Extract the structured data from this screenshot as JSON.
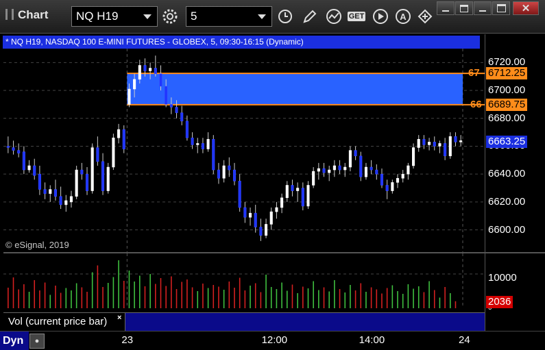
{
  "window": {
    "title": "Chart"
  },
  "toolbar": {
    "symbol": "NQ H19",
    "interval": "5",
    "icons": [
      "gear-icon",
      "clock-icon",
      "pencil-icon",
      "study-icon",
      "get-icon",
      "play-icon",
      "alert-icon",
      "cursor-icon"
    ],
    "get_label": "GET",
    "alert_label": "A"
  },
  "info_bar": {
    "text": "* NQ H19, NASDAQ 100 E-MINI FUTURES - GLOBEX, 5, 09:30-16:15 (Dynamic)"
  },
  "watermark": "© eSignal, 2019",
  "price_axis": {
    "labels": [
      "6720.00",
      "6700.00",
      "6680.00",
      "6660.00",
      "6640.00",
      "6620.00",
      "6600.00"
    ]
  },
  "price_tags": {
    "upper_level": {
      "label": "67",
      "value": "6712.25",
      "color": "#ff8c1a"
    },
    "lower_level": {
      "label": "66",
      "value": "6689.75",
      "color": "#ff8c1a"
    },
    "last": {
      "value": "6663.25",
      "color": "#1b2fe0"
    }
  },
  "volume_axis": {
    "label": "10000",
    "zero": "0"
  },
  "volume_tag": {
    "value": "2036",
    "color": "#d40000"
  },
  "volume_panel": {
    "label": "Vol (current price bar)",
    "close": "×"
  },
  "time_axis": {
    "labels": [
      "23",
      "12:00",
      "14:00",
      "24"
    ]
  },
  "status": {
    "mode": "Dyn"
  },
  "chart_data": {
    "type": "candlestick",
    "title": "",
    "y_range": [
      6588,
      6730
    ],
    "highlight_zone": {
      "low": 6689.75,
      "high": 6712.25,
      "color": "#2962ff",
      "line_color": "#ff8c1a"
    },
    "last_price": 6663.25,
    "candles": [
      {
        "o": 6660,
        "h": 6667,
        "l": 6655,
        "c": 6659
      },
      {
        "o": 6659,
        "h": 6664,
        "l": 6654,
        "c": 6657
      },
      {
        "o": 6657,
        "h": 6662,
        "l": 6652,
        "c": 6655
      },
      {
        "o": 6656,
        "h": 6660,
        "l": 6640,
        "c": 6643
      },
      {
        "o": 6643,
        "h": 6650,
        "l": 6641,
        "c": 6646
      },
      {
        "o": 6646,
        "h": 6651,
        "l": 6636,
        "c": 6639
      },
      {
        "o": 6640,
        "h": 6646,
        "l": 6625,
        "c": 6629
      },
      {
        "o": 6629,
        "h": 6634,
        "l": 6622,
        "c": 6626
      },
      {
        "o": 6626,
        "h": 6632,
        "l": 6620,
        "c": 6629
      },
      {
        "o": 6629,
        "h": 6636,
        "l": 6621,
        "c": 6624
      },
      {
        "o": 6624,
        "h": 6631,
        "l": 6615,
        "c": 6618
      },
      {
        "o": 6618,
        "h": 6625,
        "l": 6613,
        "c": 6621
      },
      {
        "o": 6620,
        "h": 6628,
        "l": 6616,
        "c": 6624
      },
      {
        "o": 6624,
        "h": 6646,
        "l": 6622,
        "c": 6643
      },
      {
        "o": 6643,
        "h": 6648,
        "l": 6636,
        "c": 6640
      },
      {
        "o": 6640,
        "h": 6645,
        "l": 6625,
        "c": 6628
      },
      {
        "o": 6628,
        "h": 6662,
        "l": 6626,
        "c": 6659
      },
      {
        "o": 6659,
        "h": 6667,
        "l": 6646,
        "c": 6649
      },
      {
        "o": 6649,
        "h": 6655,
        "l": 6625,
        "c": 6628
      },
      {
        "o": 6628,
        "h": 6648,
        "l": 6626,
        "c": 6645
      },
      {
        "o": 6645,
        "h": 6669,
        "l": 6643,
        "c": 6666
      },
      {
        "o": 6666,
        "h": 6676,
        "l": 6662,
        "c": 6672
      },
      {
        "o": 6672,
        "h": 6675,
        "l": 6655,
        "c": 6658
      },
      {
        "o": 6690,
        "h": 6705,
        "l": 6688,
        "c": 6701
      },
      {
        "o": 6701,
        "h": 6712,
        "l": 6695,
        "c": 6708
      },
      {
        "o": 6708,
        "h": 6722,
        "l": 6705,
        "c": 6718
      },
      {
        "o": 6718,
        "h": 6723,
        "l": 6710,
        "c": 6714
      },
      {
        "o": 6714,
        "h": 6720,
        "l": 6708,
        "c": 6716
      },
      {
        "o": 6716,
        "h": 6725,
        "l": 6710,
        "c": 6712
      },
      {
        "o": 6712,
        "h": 6718,
        "l": 6700,
        "c": 6703
      },
      {
        "o": 6703,
        "h": 6708,
        "l": 6688,
        "c": 6690
      },
      {
        "o": 6690,
        "h": 6695,
        "l": 6683,
        "c": 6688
      },
      {
        "o": 6688,
        "h": 6693,
        "l": 6680,
        "c": 6684
      },
      {
        "o": 6684,
        "h": 6689,
        "l": 6675,
        "c": 6678
      },
      {
        "o": 6678,
        "h": 6682,
        "l": 6664,
        "c": 6666
      },
      {
        "o": 6666,
        "h": 6670,
        "l": 6658,
        "c": 6661
      },
      {
        "o": 6661,
        "h": 6666,
        "l": 6655,
        "c": 6662
      },
      {
        "o": 6662,
        "h": 6666,
        "l": 6655,
        "c": 6658
      },
      {
        "o": 6658,
        "h": 6670,
        "l": 6656,
        "c": 6665
      },
      {
        "o": 6665,
        "h": 6668,
        "l": 6640,
        "c": 6643
      },
      {
        "o": 6643,
        "h": 6648,
        "l": 6633,
        "c": 6637
      },
      {
        "o": 6637,
        "h": 6650,
        "l": 6634,
        "c": 6646
      },
      {
        "o": 6646,
        "h": 6652,
        "l": 6638,
        "c": 6643
      },
      {
        "o": 6643,
        "h": 6648,
        "l": 6632,
        "c": 6635
      },
      {
        "o": 6635,
        "h": 6640,
        "l": 6613,
        "c": 6616
      },
      {
        "o": 6616,
        "h": 6620,
        "l": 6605,
        "c": 6609
      },
      {
        "o": 6609,
        "h": 6616,
        "l": 6603,
        "c": 6612
      },
      {
        "o": 6612,
        "h": 6618,
        "l": 6598,
        "c": 6602
      },
      {
        "o": 6602,
        "h": 6608,
        "l": 6592,
        "c": 6596
      },
      {
        "o": 6596,
        "h": 6608,
        "l": 6594,
        "c": 6604
      },
      {
        "o": 6604,
        "h": 6616,
        "l": 6600,
        "c": 6613
      },
      {
        "o": 6613,
        "h": 6620,
        "l": 6608,
        "c": 6616
      },
      {
        "o": 6616,
        "h": 6626,
        "l": 6612,
        "c": 6623
      },
      {
        "o": 6623,
        "h": 6635,
        "l": 6620,
        "c": 6632
      },
      {
        "o": 6632,
        "h": 6636,
        "l": 6624,
        "c": 6628
      },
      {
        "o": 6628,
        "h": 6634,
        "l": 6620,
        "c": 6630
      },
      {
        "o": 6630,
        "h": 6634,
        "l": 6614,
        "c": 6617
      },
      {
        "o": 6617,
        "h": 6635,
        "l": 6615,
        "c": 6632
      },
      {
        "o": 6632,
        "h": 6645,
        "l": 6630,
        "c": 6642
      },
      {
        "o": 6642,
        "h": 6648,
        "l": 6636,
        "c": 6644
      },
      {
        "o": 6644,
        "h": 6648,
        "l": 6638,
        "c": 6641
      },
      {
        "o": 6641,
        "h": 6646,
        "l": 6635,
        "c": 6643
      },
      {
        "o": 6643,
        "h": 6650,
        "l": 6638,
        "c": 6646
      },
      {
        "o": 6646,
        "h": 6650,
        "l": 6640,
        "c": 6643
      },
      {
        "o": 6643,
        "h": 6648,
        "l": 6638,
        "c": 6645
      },
      {
        "o": 6645,
        "h": 6660,
        "l": 6642,
        "c": 6657
      },
      {
        "o": 6657,
        "h": 6660,
        "l": 6650,
        "c": 6653
      },
      {
        "o": 6653,
        "h": 6656,
        "l": 6635,
        "c": 6638
      },
      {
        "o": 6638,
        "h": 6648,
        "l": 6636,
        "c": 6645
      },
      {
        "o": 6645,
        "h": 6650,
        "l": 6640,
        "c": 6643
      },
      {
        "o": 6643,
        "h": 6647,
        "l": 6636,
        "c": 6640
      },
      {
        "o": 6640,
        "h": 6644,
        "l": 6630,
        "c": 6632
      },
      {
        "o": 6632,
        "h": 6636,
        "l": 6622,
        "c": 6628
      },
      {
        "o": 6628,
        "h": 6636,
        "l": 6626,
        "c": 6634
      },
      {
        "o": 6634,
        "h": 6640,
        "l": 6630,
        "c": 6637
      },
      {
        "o": 6637,
        "h": 6643,
        "l": 6634,
        "c": 6640
      },
      {
        "o": 6640,
        "h": 6648,
        "l": 6636,
        "c": 6646
      },
      {
        "o": 6646,
        "h": 6662,
        "l": 6644,
        "c": 6659
      },
      {
        "o": 6659,
        "h": 6668,
        "l": 6656,
        "c": 6665
      },
      {
        "o": 6665,
        "h": 6668,
        "l": 6658,
        "c": 6661
      },
      {
        "o": 6661,
        "h": 6666,
        "l": 6657,
        "c": 6663
      },
      {
        "o": 6663,
        "h": 6667,
        "l": 6657,
        "c": 6660
      },
      {
        "o": 6660,
        "h": 6664,
        "l": 6655,
        "c": 6662
      },
      {
        "o": 6662,
        "h": 6666,
        "l": 6650,
        "c": 6653
      },
      {
        "o": 6653,
        "h": 6670,
        "l": 6651,
        "c": 6667
      },
      {
        "o": 6667,
        "h": 6670,
        "l": 6660,
        "c": 6663
      },
      {
        "o": 6663,
        "h": 6668,
        "l": 6660,
        "c": 6664
      }
    ],
    "volume_max": 14000,
    "volumes": [
      6000,
      9000,
      5500,
      7000,
      4800,
      8200,
      5200,
      7500,
      3900,
      6600,
      4500,
      5900,
      5200,
      7300,
      6100,
      4800,
      10500,
      12500,
      6200,
      7400,
      9100,
      14000,
      8000,
      11000,
      7800,
      9500,
      6400,
      10000,
      7100,
      8800,
      6500,
      9300,
      5600,
      7700,
      8400,
      6100,
      5000,
      7200,
      5900,
      6800,
      6300,
      5400,
      7800,
      6000,
      8900,
      5200,
      6600,
      7300,
      4700,
      9800,
      6200,
      5600,
      7500,
      5100,
      6900,
      4400,
      6300,
      5800,
      7900,
      5300,
      6100,
      4900,
      8200,
      5600,
      4600,
      6800,
      5200,
      7300,
      4800,
      6100,
      5500,
      4300,
      5900,
      6700,
      5000,
      4200,
      7000,
      5700,
      6400,
      4700,
      7900,
      5300,
      3100,
      6200,
      4400,
      2036
    ]
  }
}
